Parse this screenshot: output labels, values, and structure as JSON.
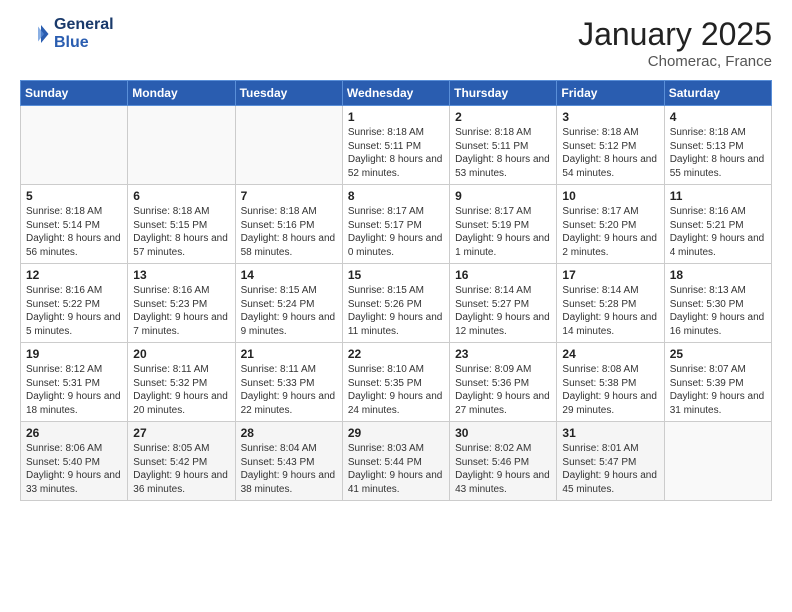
{
  "header": {
    "logo_line1": "General",
    "logo_line2": "Blue",
    "title": "January 2025",
    "location": "Chomerac, France"
  },
  "days_of_week": [
    "Sunday",
    "Monday",
    "Tuesday",
    "Wednesday",
    "Thursday",
    "Friday",
    "Saturday"
  ],
  "weeks": [
    [
      {
        "day": "",
        "text": ""
      },
      {
        "day": "",
        "text": ""
      },
      {
        "day": "",
        "text": ""
      },
      {
        "day": "1",
        "text": "Sunrise: 8:18 AM\nSunset: 5:11 PM\nDaylight: 8 hours and 52 minutes."
      },
      {
        "day": "2",
        "text": "Sunrise: 8:18 AM\nSunset: 5:11 PM\nDaylight: 8 hours and 53 minutes."
      },
      {
        "day": "3",
        "text": "Sunrise: 8:18 AM\nSunset: 5:12 PM\nDaylight: 8 hours and 54 minutes."
      },
      {
        "day": "4",
        "text": "Sunrise: 8:18 AM\nSunset: 5:13 PM\nDaylight: 8 hours and 55 minutes."
      }
    ],
    [
      {
        "day": "5",
        "text": "Sunrise: 8:18 AM\nSunset: 5:14 PM\nDaylight: 8 hours and 56 minutes."
      },
      {
        "day": "6",
        "text": "Sunrise: 8:18 AM\nSunset: 5:15 PM\nDaylight: 8 hours and 57 minutes."
      },
      {
        "day": "7",
        "text": "Sunrise: 8:18 AM\nSunset: 5:16 PM\nDaylight: 8 hours and 58 minutes."
      },
      {
        "day": "8",
        "text": "Sunrise: 8:17 AM\nSunset: 5:17 PM\nDaylight: 9 hours and 0 minutes."
      },
      {
        "day": "9",
        "text": "Sunrise: 8:17 AM\nSunset: 5:19 PM\nDaylight: 9 hours and 1 minute."
      },
      {
        "day": "10",
        "text": "Sunrise: 8:17 AM\nSunset: 5:20 PM\nDaylight: 9 hours and 2 minutes."
      },
      {
        "day": "11",
        "text": "Sunrise: 8:16 AM\nSunset: 5:21 PM\nDaylight: 9 hours and 4 minutes."
      }
    ],
    [
      {
        "day": "12",
        "text": "Sunrise: 8:16 AM\nSunset: 5:22 PM\nDaylight: 9 hours and 5 minutes."
      },
      {
        "day": "13",
        "text": "Sunrise: 8:16 AM\nSunset: 5:23 PM\nDaylight: 9 hours and 7 minutes."
      },
      {
        "day": "14",
        "text": "Sunrise: 8:15 AM\nSunset: 5:24 PM\nDaylight: 9 hours and 9 minutes."
      },
      {
        "day": "15",
        "text": "Sunrise: 8:15 AM\nSunset: 5:26 PM\nDaylight: 9 hours and 11 minutes."
      },
      {
        "day": "16",
        "text": "Sunrise: 8:14 AM\nSunset: 5:27 PM\nDaylight: 9 hours and 12 minutes."
      },
      {
        "day": "17",
        "text": "Sunrise: 8:14 AM\nSunset: 5:28 PM\nDaylight: 9 hours and 14 minutes."
      },
      {
        "day": "18",
        "text": "Sunrise: 8:13 AM\nSunset: 5:30 PM\nDaylight: 9 hours and 16 minutes."
      }
    ],
    [
      {
        "day": "19",
        "text": "Sunrise: 8:12 AM\nSunset: 5:31 PM\nDaylight: 9 hours and 18 minutes."
      },
      {
        "day": "20",
        "text": "Sunrise: 8:11 AM\nSunset: 5:32 PM\nDaylight: 9 hours and 20 minutes."
      },
      {
        "day": "21",
        "text": "Sunrise: 8:11 AM\nSunset: 5:33 PM\nDaylight: 9 hours and 22 minutes."
      },
      {
        "day": "22",
        "text": "Sunrise: 8:10 AM\nSunset: 5:35 PM\nDaylight: 9 hours and 24 minutes."
      },
      {
        "day": "23",
        "text": "Sunrise: 8:09 AM\nSunset: 5:36 PM\nDaylight: 9 hours and 27 minutes."
      },
      {
        "day": "24",
        "text": "Sunrise: 8:08 AM\nSunset: 5:38 PM\nDaylight: 9 hours and 29 minutes."
      },
      {
        "day": "25",
        "text": "Sunrise: 8:07 AM\nSunset: 5:39 PM\nDaylight: 9 hours and 31 minutes."
      }
    ],
    [
      {
        "day": "26",
        "text": "Sunrise: 8:06 AM\nSunset: 5:40 PM\nDaylight: 9 hours and 33 minutes."
      },
      {
        "day": "27",
        "text": "Sunrise: 8:05 AM\nSunset: 5:42 PM\nDaylight: 9 hours and 36 minutes."
      },
      {
        "day": "28",
        "text": "Sunrise: 8:04 AM\nSunset: 5:43 PM\nDaylight: 9 hours and 38 minutes."
      },
      {
        "day": "29",
        "text": "Sunrise: 8:03 AM\nSunset: 5:44 PM\nDaylight: 9 hours and 41 minutes."
      },
      {
        "day": "30",
        "text": "Sunrise: 8:02 AM\nSunset: 5:46 PM\nDaylight: 9 hours and 43 minutes."
      },
      {
        "day": "31",
        "text": "Sunrise: 8:01 AM\nSunset: 5:47 PM\nDaylight: 9 hours and 45 minutes."
      },
      {
        "day": "",
        "text": ""
      }
    ]
  ]
}
